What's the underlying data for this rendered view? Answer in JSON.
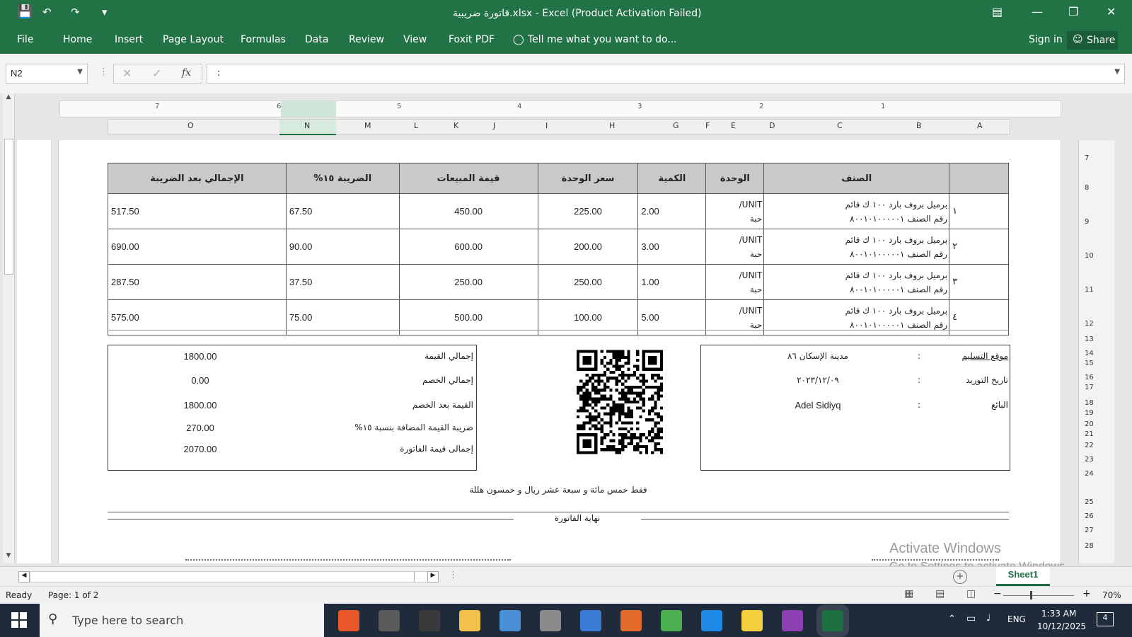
{
  "window": {
    "title": "قاتورة ضريبية.xlsx - Excel (Product Activation Failed)"
  },
  "ribbon": {
    "tabs": [
      "File",
      "Home",
      "Insert",
      "Page Layout",
      "Formulas",
      "Data",
      "Review",
      "View",
      "Foxit PDF"
    ],
    "tell_me": "Tell me what you want to do...",
    "sign_in": "Sign in",
    "share": "Share"
  },
  "formula_bar": {
    "name_box": "N2",
    "fx": "fx",
    "content": ":"
  },
  "ruler": {
    "marks": [
      "7",
      "6",
      "5",
      "4",
      "3",
      "2",
      "1"
    ]
  },
  "columns": [
    "O",
    "N",
    "M",
    "L",
    "K",
    "J",
    "I",
    "H",
    "G",
    "F",
    "E",
    "D",
    "C",
    "B",
    "A"
  ],
  "rows": [
    "7",
    "8",
    "9",
    "10",
    "11",
    "12",
    "13",
    "14",
    "15",
    "16",
    "17",
    "18",
    "19",
    "20",
    "21",
    "22",
    "23",
    "24",
    "25",
    "26",
    "27",
    "28"
  ],
  "invoice": {
    "headers": [
      "الصنف",
      "الوحدة",
      "الكمية",
      "سعر الوحدة",
      "قيمة المبيعات",
      "الضريبة ١٥%",
      "الإجمالي بعد الضريبة"
    ],
    "items": [
      {
        "index": "١",
        "name": "برميل بروف بارد ١٠٠ ك قائم",
        "code": "رقم الصنف ٨٠٠١٠١٠٠٠٠٠١",
        "unit_en": "UNIT/",
        "unit_ar": "حبة",
        "qty": "2.00",
        "unit_price": "225.00",
        "sales": "450.00",
        "tax": "67.50",
        "total": "517.50"
      },
      {
        "index": "٢",
        "name": "برميل بروف بارد ١٠٠ ك قائم",
        "code": "رقم الصنف ٨٠٠١٠١٠٠٠٠٠١",
        "unit_en": "UNIT/",
        "unit_ar": "حبة",
        "qty": "3.00",
        "unit_price": "200.00",
        "sales": "600.00",
        "tax": "90.00",
        "total": "690.00"
      },
      {
        "index": "٣",
        "name": "برميل بروف بارد ١٠٠ ك قائم",
        "code": "رقم الصنف ٨٠٠١٠١٠٠٠٠٠١",
        "unit_en": "UNIT/",
        "unit_ar": "حبة",
        "qty": "1.00",
        "unit_price": "250.00",
        "sales": "250.00",
        "tax": "37.50",
        "total": "287.50"
      },
      {
        "index": "٤",
        "name": "برميل بروف بارد ١٠٠ ك قائم",
        "code": "رقم الصنف ٨٠٠١٠١٠٠٠٠٠١",
        "unit_en": "UNIT/",
        "unit_ar": "حبة",
        "qty": "5.00",
        "unit_price": "100.00",
        "sales": "500.00",
        "tax": "75.00",
        "total": "575.00"
      }
    ],
    "totals": [
      {
        "label": "إجمالي القيمة",
        "value": "1800.00"
      },
      {
        "label": "إجمالي الخصم",
        "value": "0.00"
      },
      {
        "label": "القيمة بعد الخصم",
        "value": "1800.00"
      },
      {
        "label": "ضريبة القيمة المضافة بنسبة ١٥%",
        "value": "270.00"
      },
      {
        "label": "إجمالى قيمة الفاتورة",
        "value": "2070.00"
      }
    ],
    "delivery": [
      {
        "label": "موقع التسليم",
        "sep": ":",
        "value": "مدينة الإسكان ٨٦"
      },
      {
        "label": "تاريخ التوريد",
        "sep": ":",
        "value": "٢٠٢٣/١٢/٠٩"
      },
      {
        "label": "البائع",
        "sep": ":",
        "value": "Adel Sidiyq"
      }
    ],
    "amount_words": "فقط خمس مائة و سبعة عشر ريال و خمسون هللة",
    "end_text": "نهاية الفاتورة"
  },
  "sheet_tabs": {
    "active": "Sheet1"
  },
  "watermark": {
    "line1": "Activate Windows",
    "line2": "Go to Settings to activate Windows."
  },
  "status": {
    "ready": "Ready",
    "page": "Page: 1 of 2",
    "zoom": "70%"
  },
  "taskbar": {
    "search_placeholder": "Type here to search",
    "lang": "ENG",
    "time": "1:33 AM",
    "date": "10/12/2025",
    "notifications": "4",
    "app_colors": [
      "#e8562a",
      "#5a5a5a",
      "#3a3a3a",
      "#f2c14a",
      "#4a90d9",
      "#8a8a8a",
      "#3a7bd5",
      "#e36b2c",
      "#4caf50",
      "#1e88e5",
      "#f4d03f",
      "#8e3fb2",
      "#1d6f42"
    ]
  }
}
